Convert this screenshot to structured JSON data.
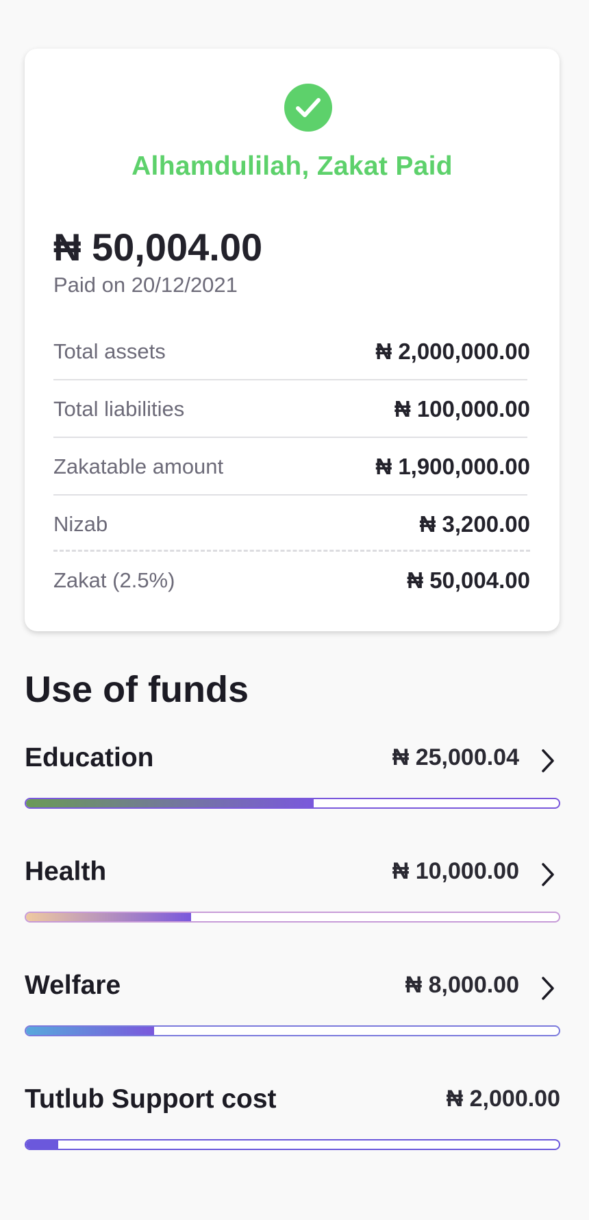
{
  "receipt": {
    "status": "Alhamdulilah, Zakat Paid",
    "total": "₦ 50,004.00",
    "paid_on": "Paid on 20/12/2021",
    "rows": [
      {
        "label": "Total assets",
        "value": "₦ 2,000,000.00"
      },
      {
        "label": "Total liabilities",
        "value": "₦ 100,000.00"
      },
      {
        "label": "Zakatable amount",
        "value": "₦ 1,900,000.00"
      },
      {
        "label": "Nizab",
        "value": "₦ 3,200.00"
      },
      {
        "label": "Zakat (2.5%)",
        "value": "₦ 50,004.00"
      }
    ]
  },
  "funds": {
    "title": "Use of funds",
    "items": [
      {
        "label": "Education",
        "amount": "₦ 25,000.04",
        "progress": 0.54,
        "gradient": [
          "#6b9a57",
          "#7a58dc"
        ],
        "border": "#7a58dc"
      },
      {
        "label": "Health",
        "amount": "₦ 10,000.00",
        "progress": 0.31,
        "gradient": [
          "#efc9a0",
          "#7a58dc"
        ],
        "border": "#c79bd8"
      },
      {
        "label": "Welfare",
        "amount": "₦ 8,000.00",
        "progress": 0.24,
        "gradient": [
          "#58a8dc",
          "#7a58dc"
        ],
        "border": "#7a79dc"
      },
      {
        "label": "Tutlub Support cost",
        "amount": "₦ 2,000.00",
        "progress": 0.06,
        "gradient": [
          "#6b58dc",
          "#6b58dc"
        ],
        "border": "#6b58dc"
      }
    ]
  },
  "colors": {
    "success": "#5dd16b",
    "accent": "#7a58dc"
  }
}
